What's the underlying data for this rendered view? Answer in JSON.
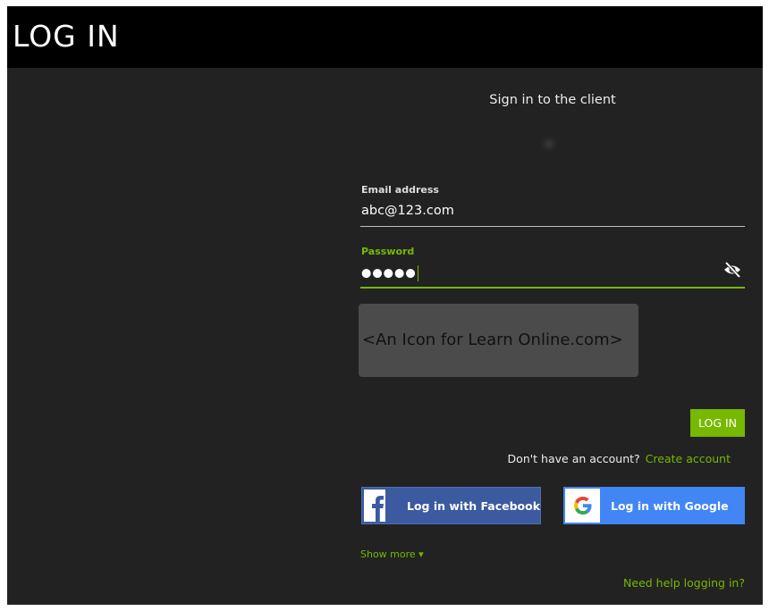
{
  "header": {
    "title": "LOG IN"
  },
  "subtitle": "Sign in to the client",
  "email": {
    "label": "Email address",
    "value": "abc@123.com"
  },
  "password": {
    "label": "Password",
    "value": "●●●●●",
    "toggle_icon": "eye-slash-icon"
  },
  "ad": {
    "text": "<An Icon for Learn Online.com>"
  },
  "login_button": "LOG IN",
  "signup": {
    "prompt": "Don't have an account?",
    "link": "Create account"
  },
  "social": {
    "facebook": {
      "label": "Log in with Facebook",
      "icon": "facebook-icon",
      "color": "#3b5aa0"
    },
    "google": {
      "label": "Log in with Google",
      "icon": "google-icon",
      "color": "#4285f4"
    }
  },
  "show_more": "Show more ▾",
  "help": "Need help logging in?",
  "colors": {
    "accent": "#76b900",
    "background": "#222222",
    "header": "#000000"
  }
}
